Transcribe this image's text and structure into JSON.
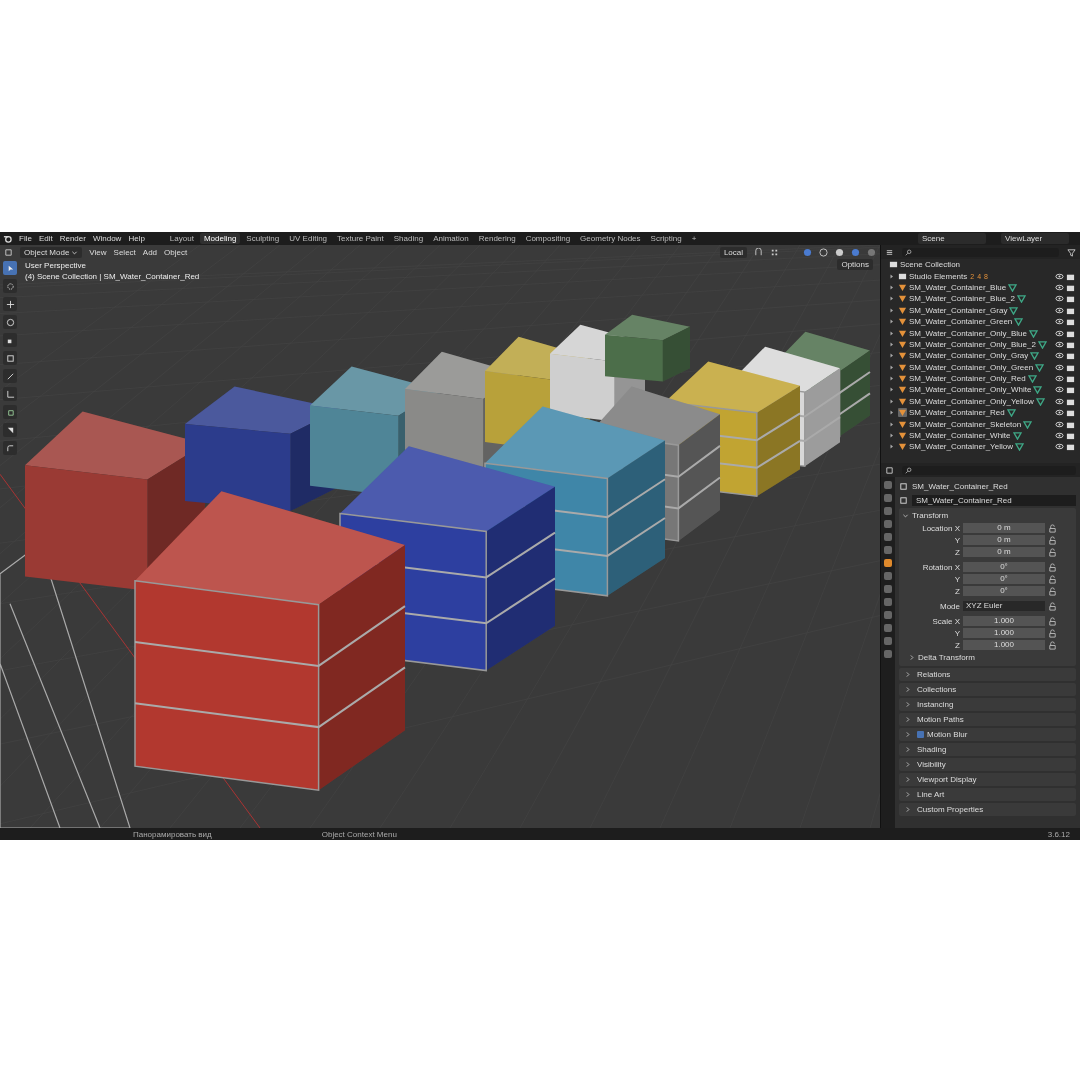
{
  "menus": [
    "File",
    "Edit",
    "Render",
    "Window",
    "Help"
  ],
  "workspaces": [
    {
      "label": "Layout",
      "selected": false
    },
    {
      "label": "Modeling",
      "selected": true
    },
    {
      "label": "Sculpting",
      "selected": false
    },
    {
      "label": "UV Editing",
      "selected": false
    },
    {
      "label": "Texture Paint",
      "selected": false
    },
    {
      "label": "Shading",
      "selected": false
    },
    {
      "label": "Animation",
      "selected": false
    },
    {
      "label": "Rendering",
      "selected": false
    },
    {
      "label": "Compositing",
      "selected": false
    },
    {
      "label": "Geometry Nodes",
      "selected": false
    },
    {
      "label": "Scripting",
      "selected": false
    }
  ],
  "add_workspace": "+",
  "scene": "Scene",
  "view_layer": "ViewLayer",
  "viewport": {
    "mode": "Object Mode",
    "menus": [
      "View",
      "Select",
      "Add",
      "Object"
    ],
    "orientation": "Local",
    "options": "Options",
    "perspective": "User Perspective",
    "context": "(4) Scene Collection | SM_Water_Container_Red",
    "tools": [
      {
        "kind": "select",
        "selected": true
      },
      {
        "kind": "cursor",
        "selected": false
      },
      {
        "kind": "move",
        "selected": false
      },
      {
        "kind": "rotate",
        "selected": false
      },
      {
        "kind": "scale",
        "selected": false
      },
      {
        "kind": "transform",
        "selected": false
      },
      {
        "kind": "annotate",
        "selected": false
      },
      {
        "kind": "measure",
        "selected": false
      },
      {
        "kind": "add_cube",
        "selected": false
      },
      {
        "kind": "extrude",
        "selected": false
      },
      {
        "kind": "bevel",
        "selected": false
      }
    ]
  },
  "outliner": {
    "root": "Scene Collection",
    "items": [
      {
        "name": "Studio Elements",
        "kind": "collection",
        "selected": false,
        "expanded": false,
        "counts": [
          "2",
          "4",
          "8"
        ]
      },
      {
        "name": "SM_Water_Container_Blue",
        "kind": "mesh",
        "selected": false,
        "expanded": false
      },
      {
        "name": "SM_Water_Container_Blue_2",
        "kind": "mesh",
        "selected": false,
        "expanded": false
      },
      {
        "name": "SM_Water_Container_Gray",
        "kind": "mesh",
        "selected": false,
        "expanded": false
      },
      {
        "name": "SM_Water_Container_Green",
        "kind": "mesh",
        "selected": false,
        "expanded": false
      },
      {
        "name": "SM_Water_Container_Only_Blue",
        "kind": "mesh",
        "selected": false,
        "expanded": false
      },
      {
        "name": "SM_Water_Container_Only_Blue_2",
        "kind": "mesh",
        "selected": false,
        "expanded": false
      },
      {
        "name": "SM_Water_Container_Only_Gray",
        "kind": "mesh",
        "selected": false,
        "expanded": false
      },
      {
        "name": "SM_Water_Container_Only_Green",
        "kind": "mesh",
        "selected": false,
        "expanded": false
      },
      {
        "name": "SM_Water_Container_Only_Red",
        "kind": "mesh",
        "selected": false,
        "expanded": false
      },
      {
        "name": "SM_Water_Container_Only_White",
        "kind": "mesh",
        "selected": false,
        "expanded": false
      },
      {
        "name": "SM_Water_Container_Only_Yellow",
        "kind": "mesh",
        "selected": false,
        "expanded": false
      },
      {
        "name": "SM_Water_Container_Red",
        "kind": "mesh",
        "selected": true,
        "expanded": false
      },
      {
        "name": "SM_Water_Container_Skeleton",
        "kind": "mesh",
        "selected": false,
        "expanded": false
      },
      {
        "name": "SM_Water_Container_White",
        "kind": "mesh",
        "selected": false,
        "expanded": false
      },
      {
        "name": "SM_Water_Container_Yellow",
        "kind": "mesh",
        "selected": false,
        "expanded": false
      }
    ]
  },
  "properties": {
    "tabs": [
      {
        "selected": false
      },
      {
        "selected": false
      },
      {
        "selected": false
      },
      {
        "selected": false
      },
      {
        "selected": false
      },
      {
        "selected": false
      },
      {
        "selected": true
      },
      {
        "selected": false
      },
      {
        "selected": false
      },
      {
        "selected": false
      },
      {
        "selected": false
      },
      {
        "selected": false
      },
      {
        "selected": false
      },
      {
        "selected": false
      }
    ],
    "object": "SM_Water_Container_Red",
    "datablock": "SM_Water_Container_Red",
    "transform": {
      "title": "Transform",
      "expanded": true,
      "rows": [
        {
          "label": "Location X",
          "value": "0 m",
          "kind": "number"
        },
        {
          "label": "Y",
          "value": "0 m",
          "kind": "number"
        },
        {
          "label": "Z",
          "value": "0 m",
          "kind": "number"
        },
        {
          "label": "Rotation X",
          "value": "0°",
          "kind": "number"
        },
        {
          "label": "Y",
          "value": "0°",
          "kind": "number"
        },
        {
          "label": "Z",
          "value": "0°",
          "kind": "number"
        },
        {
          "label": "Mode",
          "value": "XYZ Euler",
          "kind": "dropdown"
        },
        {
          "label": "Scale X",
          "value": "1.000",
          "kind": "number"
        },
        {
          "label": "Y",
          "value": "1.000",
          "kind": "number"
        },
        {
          "label": "Z",
          "value": "1.000",
          "kind": "number"
        }
      ],
      "subpanel": {
        "title": "Delta Transform",
        "expanded": false
      }
    },
    "panels": [
      {
        "title": "Relations",
        "expanded": false
      },
      {
        "title": "Collections",
        "expanded": false
      },
      {
        "title": "Instancing",
        "expanded": false
      },
      {
        "title": "Motion Paths",
        "expanded": false
      },
      {
        "title": "Motion Blur",
        "expanded": false,
        "checked": true
      },
      {
        "title": "Shading",
        "expanded": false
      },
      {
        "title": "Visibility",
        "expanded": false
      },
      {
        "title": "Viewport Display",
        "expanded": false
      },
      {
        "title": "Line Art",
        "expanded": false
      },
      {
        "title": "Custom Properties",
        "expanded": false
      }
    ]
  },
  "status_bar": {
    "hints": [
      "Панорамировать вид",
      "Object Context Menu"
    ],
    "version": "3.6.12"
  }
}
